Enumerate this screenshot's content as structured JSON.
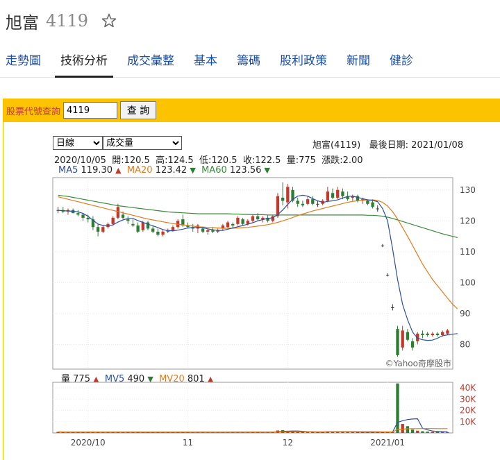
{
  "header": {
    "name": "旭富",
    "code": "4119"
  },
  "tabs": [
    "走勢圖",
    "技術分析",
    "成交彙整",
    "基本",
    "籌碼",
    "股利政策",
    "新聞",
    "健診"
  ],
  "active_tab": 1,
  "query": {
    "label": "股票代號查詢",
    "value": "4119",
    "button": "查 詢"
  },
  "selects": {
    "period": "日線",
    "indicator": "成交量"
  },
  "info": {
    "title": "旭富(4119)",
    "last_date_label": "最後日期:",
    "last_date": "2021/01/08",
    "date": "2020/10/05",
    "open_label": "開:",
    "open": "120.5",
    "high_label": "高:",
    "high": "124.5",
    "low_label": "低:",
    "low": "120.5",
    "close_label": "收:",
    "close": "122.5",
    "vol_label": "量:",
    "vol": "775",
    "change_label": "漲跌:",
    "change": "2.00"
  },
  "ma": {
    "ma5_label": "MA5",
    "ma5": "119.30",
    "ma20_label": "MA20",
    "ma20": "123.42",
    "ma60_label": "MA60",
    "ma60": "123.56"
  },
  "volume_info": {
    "vol_label": "量",
    "vol": "775",
    "mv5_label": "MV5",
    "mv5": "490",
    "mv20_label": "MV20",
    "mv20": "801"
  },
  "watermark": "©Yahoo奇摩股市",
  "colors": {
    "accent": "#fcc300",
    "up": "#c0392b",
    "down": "#2e7d32",
    "ma5": "#2b4f9e",
    "ma20": "#e07b1b",
    "ma60": "#3a8a3a"
  },
  "chart_data": {
    "type": "candlestick",
    "price_axis": {
      "ticks": [
        "130",
        "120",
        "110",
        "100",
        "90",
        "80"
      ],
      "range": [
        72,
        134
      ]
    },
    "volume_axis": {
      "ticks": [
        "40K",
        "30K",
        "20K",
        "10K"
      ],
      "range": [
        0,
        45000
      ]
    },
    "x_ticks": [
      "2020/10",
      "11",
      "12",
      "2021/01"
    ],
    "x_tick_index": [
      6,
      26,
      46,
      66
    ],
    "candles": [
      [
        123.5,
        124.5,
        122.5,
        123.5
      ],
      [
        123.5,
        124.5,
        122.5,
        123.0
      ],
      [
        123.0,
        124.0,
        122.0,
        123.5
      ],
      [
        123.5,
        124.0,
        122.5,
        122.5
      ],
      [
        122.5,
        123.5,
        121.5,
        122.0
      ],
      [
        122.0,
        122.5,
        120.0,
        121.0
      ],
      [
        121.0,
        122.0,
        119.5,
        120.5
      ],
      [
        120.5,
        121.5,
        117.0,
        118.0
      ],
      [
        118.0,
        119.0,
        115.0,
        116.5
      ],
      [
        116.5,
        118.5,
        116.0,
        118.0
      ],
      [
        118.0,
        119.5,
        117.5,
        119.0
      ],
      [
        119.0,
        121.5,
        118.5,
        121.0
      ],
      [
        121.0,
        125.5,
        120.5,
        124.5
      ],
      [
        122.0,
        123.0,
        120.5,
        121.0
      ],
      [
        120.5,
        121.5,
        119.0,
        120.0
      ],
      [
        119.0,
        120.5,
        118.0,
        118.5
      ],
      [
        118.5,
        119.5,
        116.0,
        116.5
      ],
      [
        117.0,
        120.0,
        116.5,
        119.5
      ],
      [
        119.5,
        120.0,
        117.0,
        117.5
      ],
      [
        117.5,
        118.5,
        116.0,
        116.5
      ],
      [
        116.5,
        117.5,
        115.0,
        115.5
      ],
      [
        115.5,
        117.0,
        115.0,
        116.5
      ],
      [
        116.5,
        117.5,
        116.0,
        117.0
      ],
      [
        117.0,
        118.5,
        116.5,
        118.0
      ],
      [
        118.0,
        120.5,
        117.5,
        120.0
      ],
      [
        120.5,
        122.0,
        118.0,
        118.5
      ],
      [
        118.5,
        119.5,
        117.5,
        118.0
      ],
      [
        118.0,
        119.0,
        116.5,
        117.5
      ],
      [
        117.5,
        119.0,
        116.0,
        118.5
      ],
      [
        117.5,
        118.0,
        116.0,
        116.5
      ],
      [
        116.5,
        117.5,
        115.5,
        117.0
      ],
      [
        117.0,
        118.0,
        116.0,
        116.5
      ],
      [
        116.5,
        117.5,
        116.0,
        117.0
      ],
      [
        117.5,
        119.0,
        117.0,
        118.5
      ],
      [
        118.0,
        120.0,
        117.5,
        119.5
      ],
      [
        119.0,
        119.5,
        117.5,
        118.5
      ],
      [
        119.0,
        121.5,
        118.5,
        121.0
      ],
      [
        120.5,
        121.0,
        118.5,
        119.0
      ],
      [
        119.0,
        120.5,
        118.5,
        120.0
      ],
      [
        120.0,
        122.0,
        119.5,
        121.5
      ],
      [
        121.5,
        122.5,
        120.0,
        120.5
      ],
      [
        120.5,
        121.5,
        119.5,
        121.0
      ],
      [
        121.0,
        122.0,
        119.5,
        120.0
      ],
      [
        120.0,
        122.0,
        119.5,
        121.5
      ],
      [
        121.5,
        129.0,
        121.0,
        128.0
      ],
      [
        127.5,
        132.5,
        125.0,
        126.5
      ],
      [
        126.0,
        132.0,
        124.0,
        131.0
      ],
      [
        130.0,
        131.0,
        126.0,
        126.5
      ],
      [
        126.5,
        127.5,
        124.5,
        125.5
      ],
      [
        125.5,
        126.5,
        124.5,
        125.0
      ],
      [
        125.5,
        128.0,
        125.0,
        127.0
      ],
      [
        127.0,
        128.0,
        125.0,
        125.5
      ],
      [
        125.5,
        126.5,
        124.5,
        125.5
      ],
      [
        125.5,
        127.0,
        125.0,
        126.5
      ],
      [
        126.5,
        131.0,
        126.0,
        129.5
      ],
      [
        129.0,
        130.5,
        127.0,
        127.5
      ],
      [
        127.5,
        131.0,
        127.0,
        130.0
      ],
      [
        129.5,
        130.5,
        127.0,
        128.0
      ],
      [
        128.0,
        129.5,
        126.5,
        127.0
      ],
      [
        127.5,
        128.5,
        126.5,
        128.0
      ],
      [
        128.0,
        128.5,
        126.0,
        126.5
      ],
      [
        126.5,
        127.5,
        125.5,
        127.0
      ],
      [
        126.5,
        127.0,
        125.0,
        125.5
      ],
      [
        126.0,
        127.0,
        124.0,
        124.5
      ],
      [
        124.0,
        125.0,
        123.0,
        124.0
      ],
      [
        112.0,
        112.5,
        111.5,
        112.0
      ],
      [
        102.5,
        103.0,
        102.0,
        102.5
      ],
      [
        92.0,
        93.0,
        91.0,
        92.0
      ],
      [
        85.0,
        86.0,
        76.0,
        76.5
      ],
      [
        79.0,
        86.0,
        78.0,
        84.5
      ],
      [
        84.0,
        85.0,
        81.0,
        81.5
      ],
      [
        81.0,
        82.0,
        78.0,
        79.0
      ],
      [
        81.0,
        84.0,
        80.0,
        83.5
      ],
      [
        83.5,
        84.5,
        82.0,
        83.0
      ],
      [
        83.5,
        84.0,
        82.5,
        83.0
      ],
      [
        83.0,
        84.0,
        82.5,
        83.5
      ],
      [
        83.5,
        84.0,
        82.5,
        83.0
      ],
      [
        83.0,
        84.5,
        82.5,
        84.0
      ],
      [
        83.5,
        85.0,
        83.0,
        84.5
      ]
    ],
    "volume": [
      900,
      800,
      700,
      900,
      800,
      700,
      900,
      1000,
      800,
      600,
      700,
      800,
      1200,
      800,
      700,
      600,
      900,
      700,
      600,
      800,
      700,
      900,
      700,
      600,
      800,
      900,
      700,
      800,
      900,
      700,
      600,
      800,
      700,
      700,
      900,
      800,
      900,
      700,
      800,
      900,
      700,
      800,
      700,
      900,
      2200,
      2500,
      1500,
      1600,
      900,
      800,
      700,
      900,
      800,
      700,
      1500,
      1200,
      1100,
      1000,
      900,
      800,
      900,
      800,
      900,
      1000,
      900,
      800,
      600,
      800,
      44000,
      8000,
      6000,
      3000,
      2000,
      1500,
      1200,
      1000,
      900,
      1000,
      775
    ],
    "ma5": [
      123.4,
      123.3,
      123.2,
      123.1,
      122.9,
      122.4,
      121.5,
      120.2,
      119.0,
      118.5,
      118.3,
      118.7,
      119.6,
      120.3,
      120.8,
      120.8,
      120.1,
      119.5,
      118.9,
      118.4,
      117.8,
      117.2,
      116.8,
      116.8,
      117.0,
      117.3,
      117.7,
      117.8,
      117.9,
      117.8,
      117.4,
      117.1,
      116.9,
      116.9,
      117.3,
      117.7,
      118.1,
      118.5,
      118.9,
      119.4,
      120.0,
      120.4,
      120.8,
      121.0,
      122.0,
      123.5,
      125.3,
      127.0,
      128.0,
      128.3,
      128.0,
      127.2,
      126.5,
      126.0,
      126.3,
      126.5,
      126.8,
      127.4,
      127.9,
      128.0,
      127.6,
      127.2,
      126.8,
      126.6,
      126.2,
      124.0,
      120.0,
      111.0,
      101.0,
      93.0,
      88.0,
      84.0,
      82.0,
      81.5,
      81.3,
      81.4,
      82.0,
      82.8,
      83.1,
      83.3,
      83.5
    ],
    "ma20": [
      127.8,
      127.4,
      127.0,
      126.6,
      126.2,
      125.8,
      125.4,
      125.0,
      124.6,
      124.2,
      123.8,
      123.4,
      123.0,
      122.6,
      122.2,
      121.8,
      121.4,
      121.0,
      120.6,
      120.3,
      120.0,
      119.7,
      119.4,
      119.1,
      118.9,
      118.7,
      118.5,
      118.3,
      118.1,
      118.0,
      117.9,
      117.8,
      117.7,
      117.6,
      117.6,
      117.6,
      117.7,
      117.8,
      117.9,
      118.1,
      118.3,
      118.5,
      118.8,
      119.1,
      119.5,
      120.0,
      120.5,
      121.1,
      121.7,
      122.2,
      122.7,
      123.2,
      123.6,
      124.0,
      124.4,
      124.8,
      125.2,
      125.6,
      126.0,
      126.3,
      126.5,
      126.7,
      126.8,
      126.8,
      126.6,
      126.0,
      124.8,
      123.0,
      120.6,
      117.8,
      115.0,
      112.0,
      109.0,
      106.0,
      103.5,
      101.0,
      99.0,
      97.0,
      95.0,
      93.0,
      91.5
    ],
    "ma60": [
      128.3,
      128.1,
      127.9,
      127.6,
      127.3,
      127.0,
      126.7,
      126.4,
      126.1,
      125.8,
      125.5,
      125.2,
      124.9,
      124.7,
      124.5,
      124.3,
      124.1,
      123.9,
      123.7,
      123.5,
      123.3,
      123.1,
      122.9,
      122.8,
      122.7,
      122.6,
      122.5,
      122.4,
      122.3,
      122.3,
      122.3,
      122.3,
      122.3,
      122.3,
      122.3,
      122.2,
      122.2,
      122.1,
      122.1,
      122.0,
      122.0,
      122.0,
      121.9,
      121.9,
      121.9,
      121.9,
      121.9,
      121.9,
      121.9,
      121.9,
      121.9,
      121.9,
      121.9,
      121.9,
      121.9,
      121.9,
      121.9,
      121.9,
      121.9,
      121.9,
      121.9,
      121.9,
      121.8,
      121.8,
      121.7,
      121.5,
      121.2,
      120.8,
      120.3,
      119.8,
      119.3,
      118.8,
      118.3,
      117.8,
      117.3,
      116.8,
      116.3,
      115.8,
      115.4,
      115.0,
      114.6
    ]
  }
}
